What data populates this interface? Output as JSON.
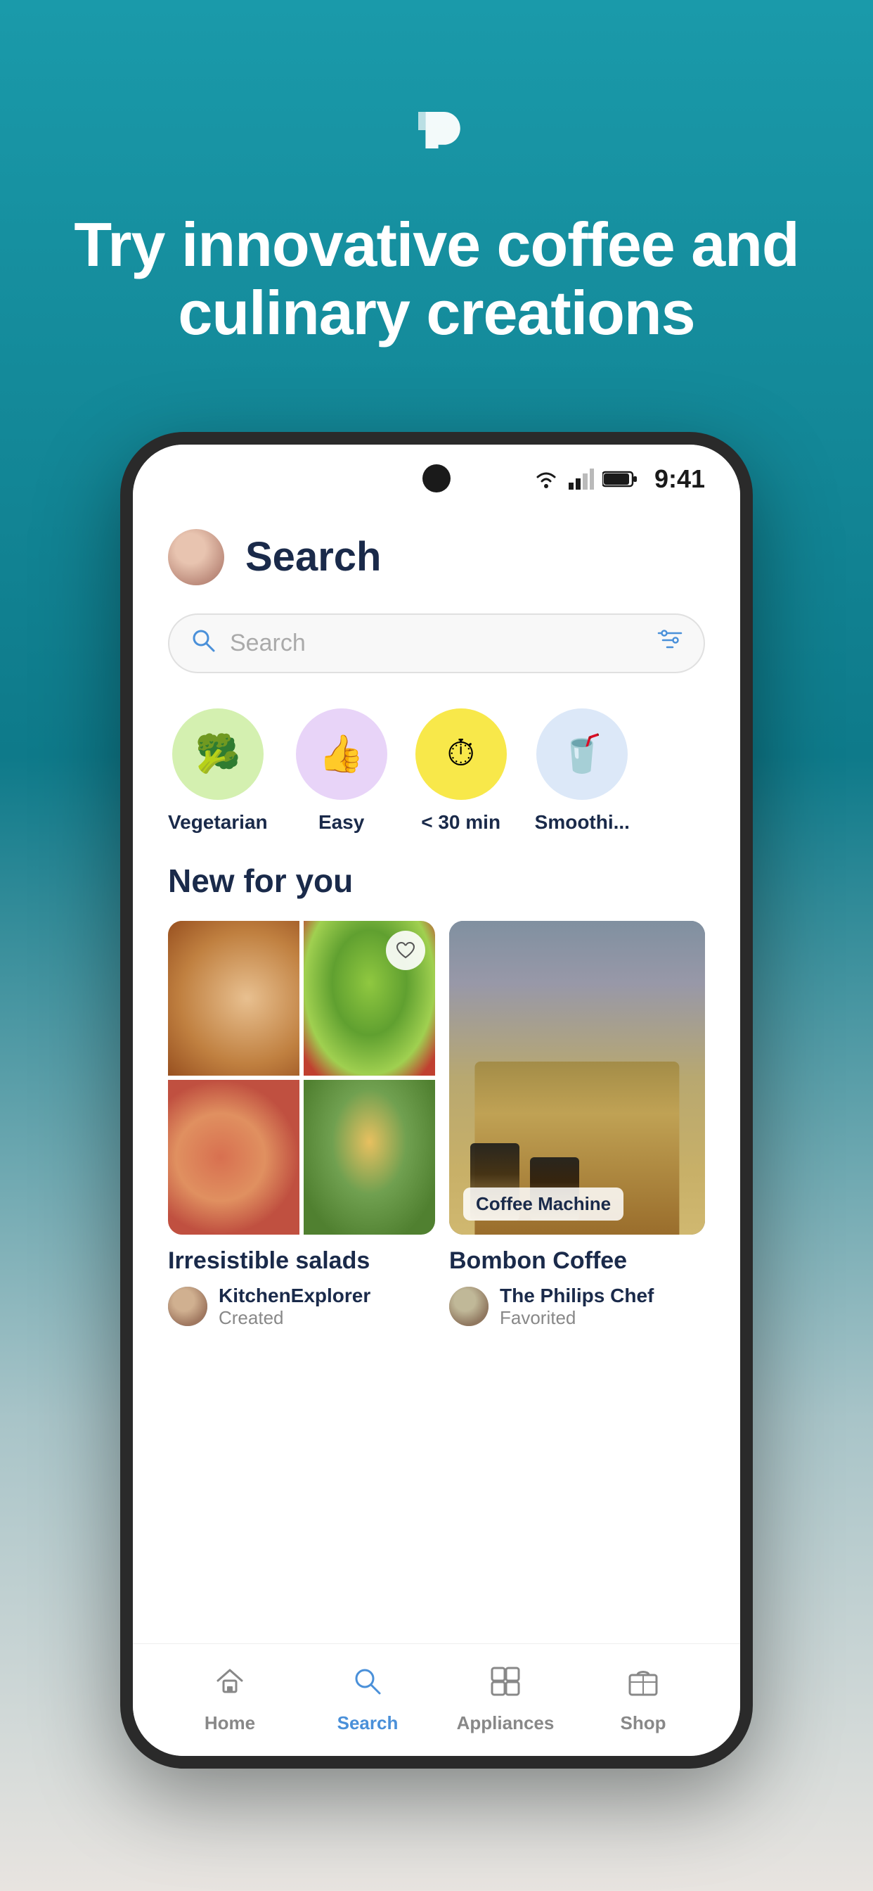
{
  "hero": {
    "title": "Try innovative coffee and culinary creations"
  },
  "status_bar": {
    "time": "9:41"
  },
  "header": {
    "title": "Search"
  },
  "search": {
    "placeholder": "Search"
  },
  "categories": [
    {
      "id": "vegetarian",
      "label": "Vegetarian",
      "color": "green",
      "icon": "🥦"
    },
    {
      "id": "easy",
      "label": "Easy",
      "color": "purple",
      "icon": "👍"
    },
    {
      "id": "under30",
      "label": "< 30 min",
      "color": "yellow",
      "icon": "⏱"
    },
    {
      "id": "smoothie",
      "label": "Smoothi...",
      "color": "lightblue",
      "icon": "🥤"
    }
  ],
  "section": {
    "title": "New for you"
  },
  "cards": {
    "left": {
      "name": "Irresistible salads",
      "author_name": "KitchenExplorer",
      "author_action": "Created"
    },
    "right": {
      "badge": "Coffee Machine",
      "name": "Bombon Coffee",
      "author_name": "The Philips Chef",
      "author_action": "Favorited"
    }
  },
  "nav": {
    "items": [
      {
        "id": "home",
        "label": "Home",
        "active": false
      },
      {
        "id": "search",
        "label": "Search",
        "active": true
      },
      {
        "id": "appliances",
        "label": "Appliances",
        "active": false
      },
      {
        "id": "shop",
        "label": "Shop",
        "active": false
      }
    ]
  }
}
